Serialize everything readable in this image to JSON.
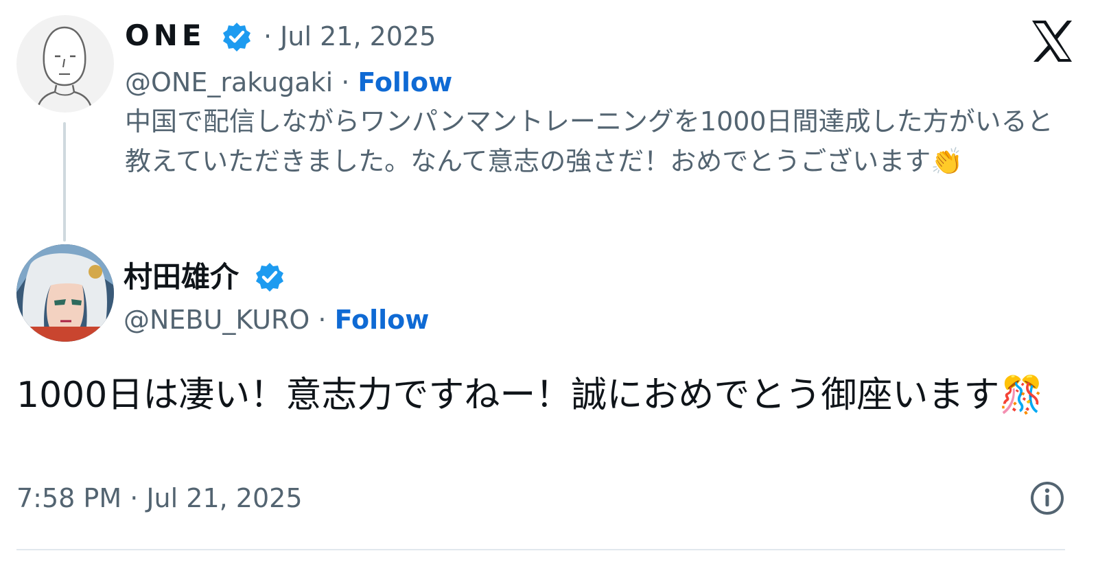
{
  "brand": {
    "logo_icon": "x-logo-icon",
    "accent": "#0f6ad4",
    "verified_color": "#1d9bf0"
  },
  "parent_tweet": {
    "display_name": "ONE",
    "verified_icon": "verified-badge-icon",
    "separator_date": "· Jul 21, 2025",
    "handle": "@ONE_rakugaki",
    "dot": " · ",
    "follow_label": "Follow",
    "text": "中国で配信しながらワンパンマントレーニングを1000日間達成した方がいると教えていただきました。なんて意志の強さだ！おめでとうございます👏"
  },
  "reply_tweet": {
    "display_name": "村田雄介",
    "verified_icon": "verified-badge-icon",
    "handle": "@NEBU_KURO",
    "dot": " · ",
    "follow_label": "Follow",
    "text": "1000日は凄い！意志力ですねー！誠におめでとう御座います🎊"
  },
  "footer": {
    "timestamp": "7:58 PM · Jul 21, 2025",
    "info_icon": "info-icon"
  }
}
